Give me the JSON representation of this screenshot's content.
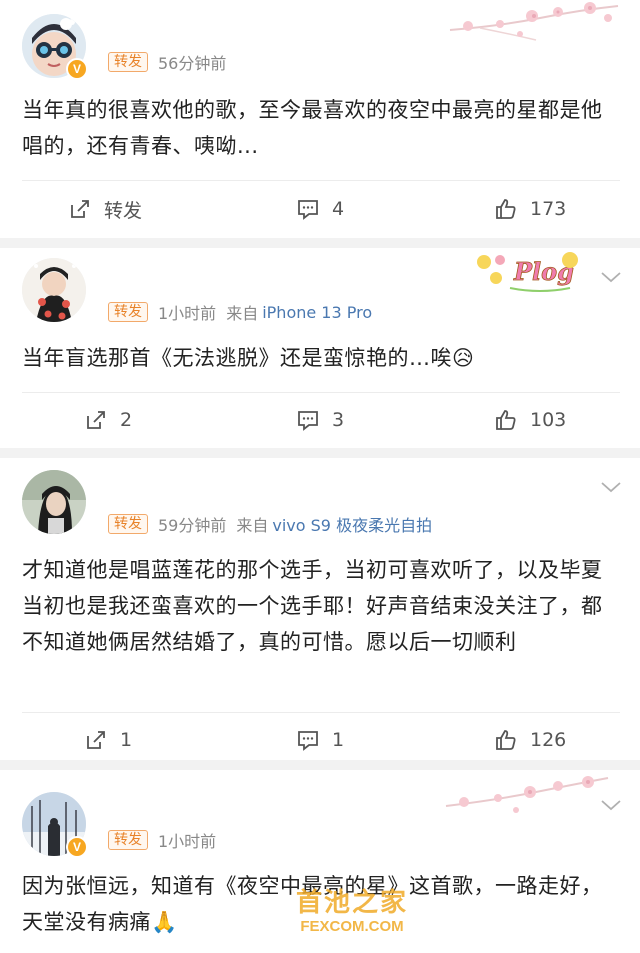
{
  "comments": [
    {
      "badge": "转发",
      "time": "56分钟前",
      "from_label": "",
      "device": "",
      "text": "当年真的很喜欢他的歌，至今最喜欢的夜空中最亮的星都是他唱的，还有青春、咦呦...",
      "repost_label": "转发",
      "comment_count": "4",
      "like_count": "173",
      "verified": "V"
    },
    {
      "badge": "转发",
      "time": "1小时前",
      "from_label": "来自",
      "device": "iPhone 13 Pro",
      "text": "当年盲选那首《无法逃脱》还是蛮惊艳的…唉😥",
      "repost_count": "2",
      "comment_count": "3",
      "like_count": "103",
      "decoration_text": "Plog"
    },
    {
      "badge": "转发",
      "time": "59分钟前",
      "from_label": "来自",
      "device": "vivo S9 极夜柔光自拍",
      "text": "才知道他是唱蓝莲花的那个选手，当初可喜欢听了，以及毕夏当初也是我还蛮喜欢的一个选手耶！好声音结束没关注了，都不知道她俩居然结婚了，真的可惜。愿以后一切顺利",
      "repost_count": "1",
      "comment_count": "1",
      "like_count": "126"
    },
    {
      "badge": "转发",
      "time": "1小时前",
      "from_label": "",
      "device": "",
      "text": "因为张恒远，知道有《夜空中最亮的星》这首歌，一路走好，天堂没有病痛🙏",
      "verified": "V"
    }
  ],
  "watermark": {
    "line1": "首池之家",
    "line2": "FEXCOM.COM"
  },
  "colors": {
    "badge_text": "#e8832a",
    "badge_border": "#f2a96a",
    "device_link": "#4a78b0",
    "verified": "#f7a721",
    "separator": "#f2f2f2"
  },
  "icons": [
    "repost-icon",
    "comment-icon",
    "like-icon",
    "chevron-down-icon",
    "verified-badge-icon",
    "cherry-blossom-decoration",
    "plog-sticker-decoration"
  ]
}
